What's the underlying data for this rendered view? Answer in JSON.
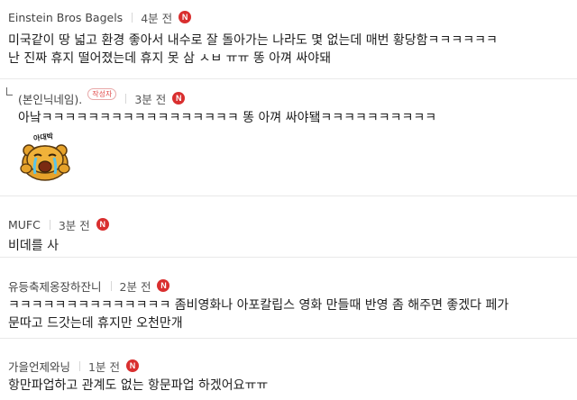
{
  "comments": [
    {
      "author": "Einstein Bros Bagels",
      "time": "4분 전",
      "badge": "N",
      "lines": [
        "미국같이 땅 넓고 환경 좋아서 내수로 잘 돌아가는 나라도 몇 없는데 매번 황당함ㅋㅋㅋㅋㅋㅋ",
        "난 진짜 휴지 떨어졌는데 휴지 못 삼 ㅅㅂ ㅠㅠ 똥 아껴 싸야돼"
      ]
    },
    {
      "author": "(본인닉네임).",
      "writer_label": "작성자",
      "time": "3분 전",
      "badge": "N",
      "lines": [
        "아낰ㅋㅋㅋㅋㅋㅋㅋㅋㅋㅋㅋㅋㅋㅋㅋㅋㅋ 똥 아껴 싸야됔ㅋㅋㅋㅋㅋㅋㅋㅋㅋㅋ"
      ],
      "sticker_text": "아대박"
    },
    {
      "author": "MUFC",
      "time": "3분 전",
      "badge": "N",
      "lines": [
        "비데를 사"
      ]
    },
    {
      "author": "유등축제옹장하잔니",
      "time": "2분 전",
      "badge": "N",
      "lines": [
        "ㅋㅋㅋㅋㅋㅋㅋㅋㅋㅋㅋㅋㅋㅋ 좀비영화나 아포칼립스 영화 만들때 반영 좀 해주면 좋겠다 페가",
        "문따고 드갓는데 휴지만 오천만개"
      ]
    },
    {
      "author": "가을언제와닝",
      "time": "1분 전",
      "badge": "N",
      "lines": [
        "항만파업하고 관계도 없는 항문파업 하겠어요ㅠㅠ"
      ]
    }
  ]
}
